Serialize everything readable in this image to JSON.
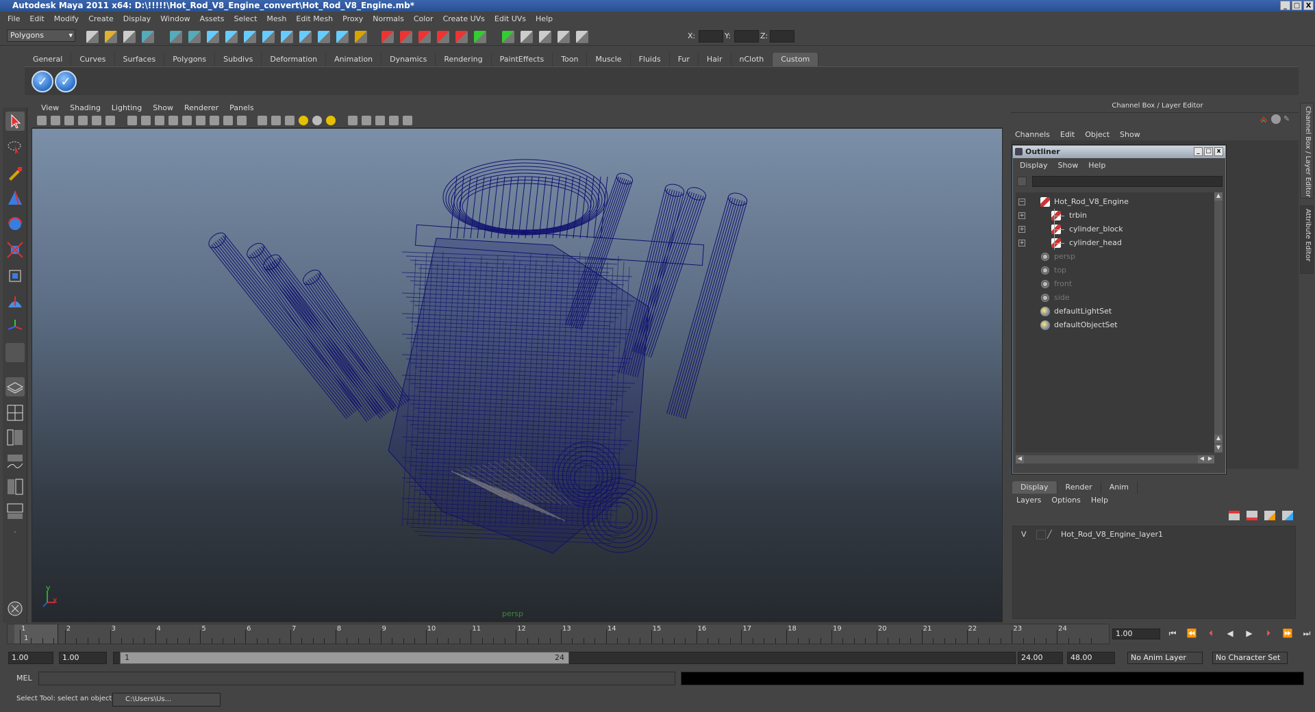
{
  "window": {
    "title": "Autodesk Maya 2011 x64: D:\\!!!!!\\Hot_Rod_V8_Engine_convert\\Hot_Rod_V8_Engine.mb*",
    "buttons": [
      "_",
      "□",
      "X"
    ]
  },
  "menubar": [
    "File",
    "Edit",
    "Modify",
    "Create",
    "Display",
    "Window",
    "Assets",
    "Select",
    "Mesh",
    "Edit Mesh",
    "Proxy",
    "Normals",
    "Color",
    "Create UVs",
    "Edit UVs",
    "Help"
  ],
  "status": {
    "mode": "Polygons",
    "x_label": "X:",
    "y_label": "Y:",
    "z_label": "Z:"
  },
  "shelf": {
    "tabs": [
      "General",
      "Curves",
      "Surfaces",
      "Polygons",
      "Subdivs",
      "Deformation",
      "Animation",
      "Dynamics",
      "Rendering",
      "PaintEffects",
      "Toon",
      "Muscle",
      "Fluids",
      "Fur",
      "Hair",
      "nCloth",
      "Custom"
    ],
    "active_tab": "Custom"
  },
  "viewport": {
    "menu": [
      "View",
      "Shading",
      "Lighting",
      "Show",
      "Renderer",
      "Panels"
    ],
    "camera_label": "persp",
    "axis_x": "x",
    "axis_y": "y",
    "wire_color": "#10106e"
  },
  "channel_box": {
    "header": "Channel Box / Layer Editor",
    "menu": [
      "Channels",
      "Edit",
      "Object",
      "Show"
    ],
    "side_tabs": [
      "Channel Box / Layer Editor",
      "Attribute Editor"
    ]
  },
  "outliner": {
    "title": "Outliner",
    "menu": [
      "Display",
      "Show",
      "Help"
    ],
    "items": [
      {
        "label": "Hot_Rod_V8_Engine",
        "icon": "mesh-icon",
        "expand": "−",
        "level": 0,
        "dim": false
      },
      {
        "label": "trbin",
        "icon": "mesh-icon",
        "expand": "+",
        "level": 1,
        "dim": false
      },
      {
        "label": "cylinder_block",
        "icon": "mesh-icon",
        "expand": "+",
        "level": 1,
        "dim": false
      },
      {
        "label": "cylinder_head",
        "icon": "mesh-icon",
        "expand": "+",
        "level": 1,
        "dim": false
      },
      {
        "label": "persp",
        "icon": "camera-icon",
        "expand": "",
        "level": 0,
        "dim": true
      },
      {
        "label": "top",
        "icon": "camera-icon",
        "expand": "",
        "level": 0,
        "dim": true
      },
      {
        "label": "front",
        "icon": "camera-icon",
        "expand": "",
        "level": 0,
        "dim": true
      },
      {
        "label": "side",
        "icon": "camera-icon",
        "expand": "",
        "level": 0,
        "dim": true
      },
      {
        "label": "defaultLightSet",
        "icon": "set-icon",
        "expand": "",
        "level": 0,
        "dim": false
      },
      {
        "label": "defaultObjectSet",
        "icon": "set-icon",
        "expand": "",
        "level": 0,
        "dim": false
      }
    ]
  },
  "layer_editor": {
    "tabs": [
      "Display",
      "Render",
      "Anim"
    ],
    "active_tab": "Display",
    "menu": [
      "Layers",
      "Options",
      "Help"
    ],
    "layers": [
      {
        "visible": "V",
        "name": "Hot_Rod_V8_Engine_layer1"
      }
    ]
  },
  "time_slider": {
    "ticks": [
      "1",
      "2",
      "3",
      "4",
      "5",
      "6",
      "7",
      "8",
      "9",
      "10",
      "11",
      "12",
      "13",
      "14",
      "15",
      "16",
      "17",
      "18",
      "19",
      "20",
      "21",
      "22",
      "23",
      "24"
    ],
    "current_frame": "1.00",
    "start_marker": "1"
  },
  "range": {
    "start": "1.00",
    "playback_start": "1.00",
    "handle_start": "1",
    "handle_end": "24",
    "playback_end": "24.00",
    "end": "48.00",
    "anim_layer": "No Anim Layer",
    "character_set": "No Character Set"
  },
  "command_line": {
    "label": "MEL"
  },
  "help_line": {
    "text": "Select Tool: select an object",
    "task": "C:\\Users\\Us..."
  }
}
